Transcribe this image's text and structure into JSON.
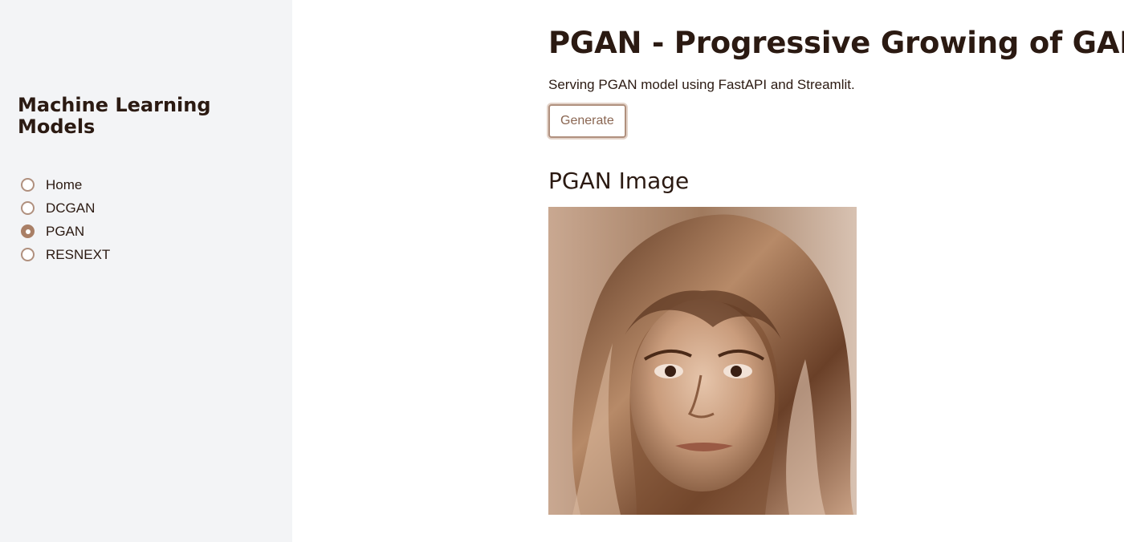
{
  "sidebar": {
    "title": "Machine Learning Models",
    "nav_options": [
      {
        "label": "Home",
        "selected": false
      },
      {
        "label": "DCGAN",
        "selected": false
      },
      {
        "label": "PGAN",
        "selected": true
      },
      {
        "label": "RESNEXT",
        "selected": false
      }
    ]
  },
  "main": {
    "title": "PGAN - Progressive Growing of GANS",
    "description": "Serving PGAN model using FastAPI and Streamlit.",
    "generate_label": "Generate",
    "image_heading": "PGAN Image"
  },
  "colors": {
    "accent": "#a97f66",
    "text": "#2b1a12",
    "sidebar_bg": "#f3f4f6"
  }
}
